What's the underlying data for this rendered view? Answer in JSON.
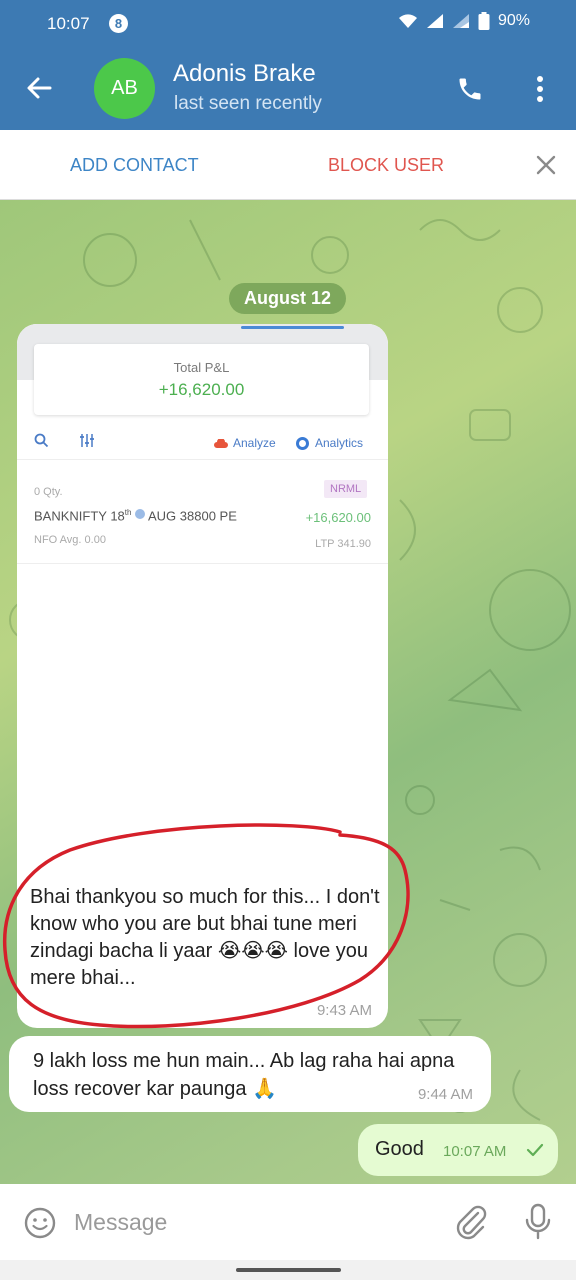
{
  "status_bar": {
    "time": "10:07",
    "notification_count": "8",
    "battery": "90%",
    "icons": [
      "wifi-icon",
      "signal-icon",
      "signal-icon",
      "battery-icon"
    ]
  },
  "header": {
    "avatar_initials": "AB",
    "avatar_color": "#4cc84a",
    "contact_name": "Adonis Brake",
    "status": "last seen recently",
    "bar_color": "#3d7ab3",
    "icons": [
      "back-arrow-icon",
      "phone-icon",
      "more-vert-icon"
    ]
  },
  "action_bar": {
    "add_contact": "ADD CONTACT",
    "block_user": "BLOCK USER",
    "close_icon": "close-icon"
  },
  "chat": {
    "date": "August 12",
    "image_message": {
      "screenshot": {
        "total_pnl_label": "Total P&L",
        "total_pnl_value": "+16,620.00",
        "analyze": "Analyze",
        "analytics": "Analytics",
        "position": {
          "qty": "0 Qty.",
          "product": "NRML",
          "symbol": "BANKNIFTY 18",
          "symbol_sup": "th",
          "contract": "AUG 38800 PE",
          "pnl": "+16,620.00",
          "exchange": "NFO  Avg. 0.00",
          "ltp": "LTP 341.90"
        }
      },
      "caption": "Bhai thankyou so much for this... I don't know who you are but bhai tune meri zindagi bacha li yaar 😭😭😭 love you mere bhai...",
      "time": "9:43 AM"
    },
    "incoming_message": {
      "text": "9 lakh loss me hun main... Ab lag raha hai apna loss recover kar paunga 🙏",
      "time": "9:44 AM"
    },
    "outgoing_message": {
      "text": "Good",
      "time": "10:07 AM",
      "status_icon": "check-icon"
    }
  },
  "composer": {
    "placeholder": "Message",
    "icons": [
      "emoji-icon",
      "attach-icon",
      "mic-icon"
    ]
  }
}
